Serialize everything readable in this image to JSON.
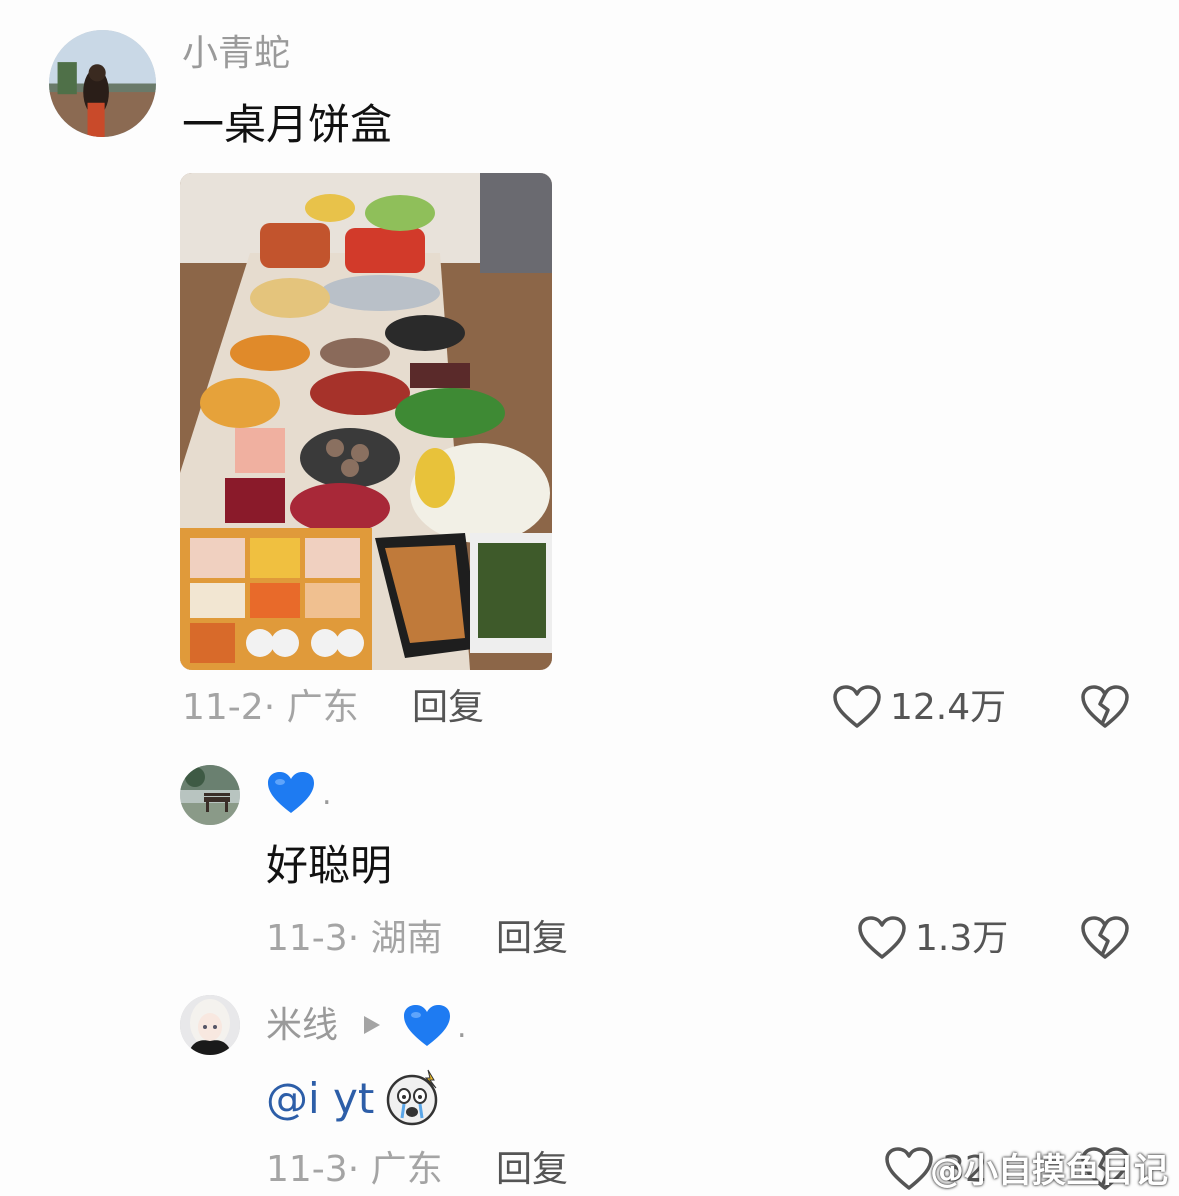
{
  "comments": [
    {
      "username": "小青蛇",
      "text": "一桌月饼盒",
      "date_location": "11-2· 广东",
      "reply_label": "回复",
      "like_count": "12.4万"
    },
    {
      "username_dot": ".",
      "text": "好聪明",
      "date_location": "11-3· 湖南",
      "reply_label": "回复",
      "like_count": "1.3万"
    },
    {
      "username": "米线",
      "username_dot": ".",
      "mention": "@i yt",
      "date_location": "11-3· 广东",
      "reply_label": "回复",
      "like_count": "32"
    }
  ],
  "watermark": "@小自摸鱼日记",
  "colors": {
    "heart_blue": "#1e7bf2",
    "mention_blue": "#2d5ea8",
    "meta_gray": "#a4a4a4"
  },
  "icons": {
    "like": "heart-outline-icon",
    "dislike": "broken-heart-icon",
    "arrow": "triangle-right-icon",
    "blue_heart": "blue-heart-emoji",
    "emoji": "crying-face-emoji"
  }
}
